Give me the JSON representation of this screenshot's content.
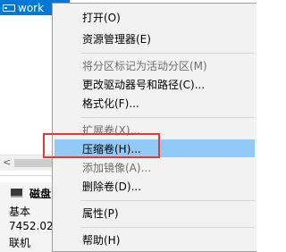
{
  "volume": {
    "name": "work"
  },
  "disk": {
    "name": "磁盘",
    "type": "基本",
    "size": "7452.02",
    "status": "联机"
  },
  "context_menu": {
    "items": [
      {
        "label": "打开(O)",
        "enabled": true
      },
      {
        "label": "资源管理器(E)",
        "enabled": true
      },
      {
        "label": "将分区标记为活动分区(M)",
        "enabled": false
      },
      {
        "label": "更改驱动器号和路径(C)...",
        "enabled": true
      },
      {
        "label": "格式化(F)...",
        "enabled": true
      },
      {
        "label": "扩展卷(X)...",
        "enabled": false
      },
      {
        "label": "压缩卷(H)...",
        "enabled": true,
        "highlighted": true
      },
      {
        "label": "添加镜像(A)...",
        "enabled": false
      },
      {
        "label": "删除卷(D)...",
        "enabled": true
      },
      {
        "label": "属性(P)",
        "enabled": true
      },
      {
        "label": "帮助(H)",
        "enabled": true
      }
    ]
  },
  "colors": {
    "selection": "#0078d7",
    "menu_background": "#f2f2f2",
    "menu_highlight": "#91c9f7",
    "annotation_outline": "#e53935"
  }
}
